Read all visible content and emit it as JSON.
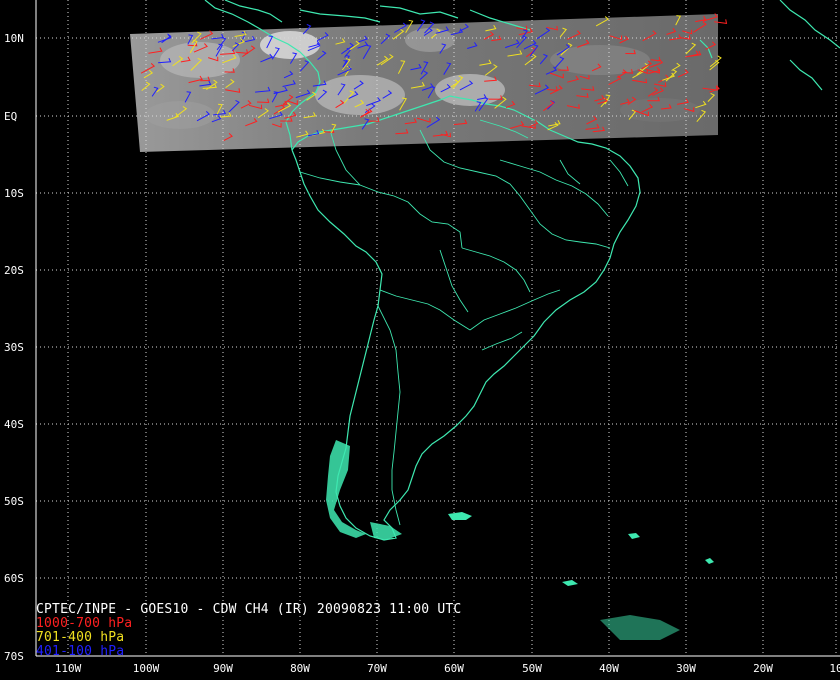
{
  "map": {
    "latitude_labels": [
      "10N",
      "EQ",
      "10S",
      "20S",
      "30S",
      "40S",
      "50S",
      "60S",
      "70S"
    ],
    "longitude_labels": [
      "110W",
      "100W",
      "90W",
      "80W",
      "70W",
      "60W",
      "50W",
      "40W",
      "30W",
      "20W",
      "10"
    ],
    "grid_color": "#d8d8d8",
    "coastline_color": "#3ee8b0",
    "background_color": "#000000"
  },
  "legend": {
    "title": "CPTEC/INPE - GOES10 - CDW CH4 (IR) 20090823 11:00 UTC",
    "levels": [
      {
        "label": "1000-700 hPa",
        "color": "#ff2020"
      },
      {
        "label": "701-400 hPa",
        "color": "#f0e020"
      },
      {
        "label": "401-100 hPa",
        "color": "#2020ff"
      }
    ]
  }
}
